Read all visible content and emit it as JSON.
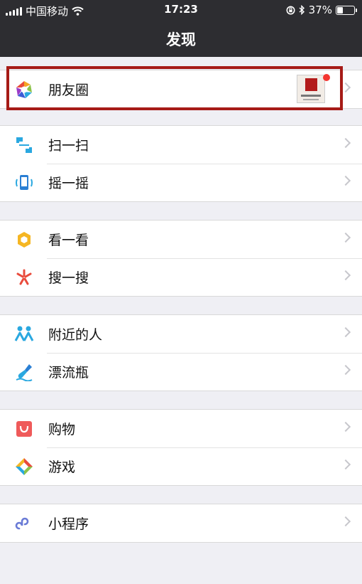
{
  "status_bar": {
    "carrier": "中国移动",
    "time": "17:23",
    "battery": "37%",
    "battery_level": 0.37
  },
  "header": {
    "title": "发现"
  },
  "sections": [
    {
      "items": [
        {
          "label": "朋友圈",
          "icon": "moments-aperture-icon",
          "has_new_dot": true
        }
      ]
    },
    {
      "items": [
        {
          "label": "扫一扫",
          "icon": "scan-icon"
        },
        {
          "label": "摇一摇",
          "icon": "shake-phone-icon"
        }
      ]
    },
    {
      "items": [
        {
          "label": "看一看",
          "icon": "top-stories-icon"
        },
        {
          "label": "搜一搜",
          "icon": "search-sparkle-icon"
        }
      ]
    },
    {
      "items": [
        {
          "label": "附近的人",
          "icon": "people-nearby-icon"
        },
        {
          "label": "漂流瓶",
          "icon": "drift-bottle-icon"
        }
      ]
    },
    {
      "items": [
        {
          "label": "购物",
          "icon": "shopping-bag-icon"
        },
        {
          "label": "游戏",
          "icon": "games-diamond-icon"
        }
      ]
    },
    {
      "items": [
        {
          "label": "小程序",
          "icon": "mini-programs-icon"
        }
      ]
    }
  ],
  "colors": {
    "header_bg": "#2d2d31",
    "page_bg": "#efeff4",
    "highlight_border": "#a61b17",
    "notification_dot": "#f43530"
  }
}
